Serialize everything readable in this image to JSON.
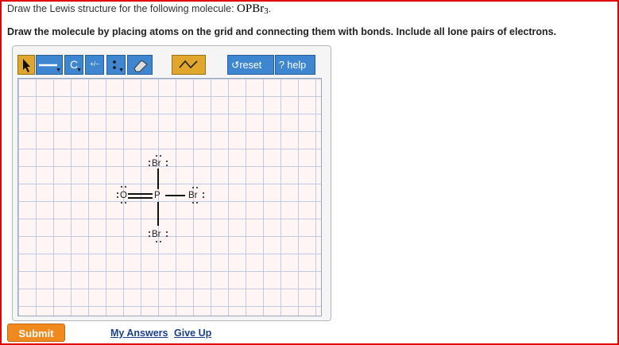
{
  "question": {
    "prefix": "Draw the Lewis structure for the following molecule: ",
    "formula_main": "OPBr",
    "formula_sub": "3",
    "suffix": "."
  },
  "instructions": "Draw the molecule by placing atoms on the grid and connecting them with bonds. Include all lone pairs of electrons.",
  "toolbar": {
    "carbon_label": "C",
    "charge_label": "+/−",
    "reset_label": "↺reset",
    "help_label": "? help"
  },
  "side_tools": [
    "remove-charges",
    "lone-pair-remove",
    "radical-remove",
    "lone-pair"
  ],
  "molecule": {
    "atoms": {
      "br_top": "Br",
      "o": "O",
      "p": "P",
      "br_right": "Br",
      "br_bottom": "Br"
    }
  },
  "footer": {
    "submit_label": "Submit",
    "my_answers_label": "My Answers",
    "give_up_label": "Give Up"
  },
  "colors": {
    "border": "#e00000",
    "toolbar_blue": "#3f86d0",
    "toolbar_orange": "#e0a62e",
    "submit": "#f08a1e",
    "link": "#1a3f8c"
  }
}
